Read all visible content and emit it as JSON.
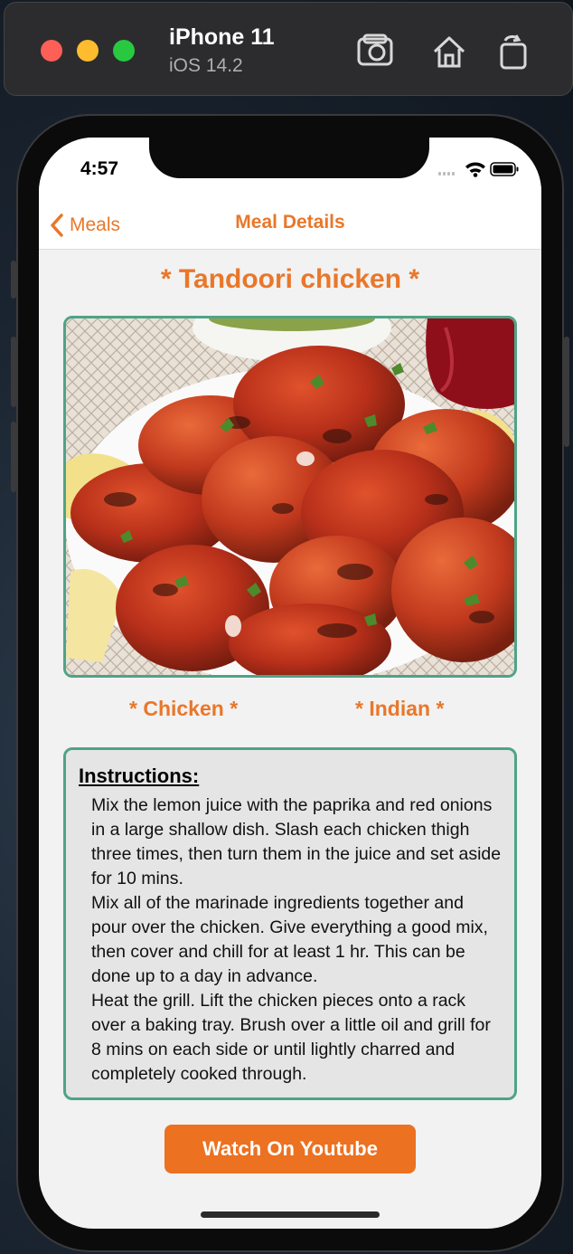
{
  "simulator": {
    "device": "iPhone 11",
    "os": "iOS 14.2"
  },
  "status_bar": {
    "time": "4:57"
  },
  "nav": {
    "back_label": "Meals",
    "title": "Meal Details"
  },
  "meal": {
    "title": "* Tandoori chicken *",
    "category": "* Chicken *",
    "area": "* Indian *",
    "image_subject": "tandoori-chicken-photo"
  },
  "instructions": {
    "heading": "Instructions:",
    "text": "Mix the lemon juice with the paprika and red onions in a large shallow dish. Slash each chicken thigh three times, then turn them in the juice and set aside for 10 mins.\nMix all of the marinade ingredients together and pour over the chicken. Give everything a good mix, then cover and chill for at least 1 hr. This can be done up to a day in advance.\nHeat the grill. Lift the chicken pieces onto a rack over a baking tray. Brush over a little oil and grill for 8 mins on each side or until lightly charred and completely cooked through."
  },
  "actions": {
    "youtube_label": "Watch On Youtube"
  },
  "colors": {
    "accent": "#e9772a",
    "border": "#4fa387",
    "button": "#ec7120"
  }
}
